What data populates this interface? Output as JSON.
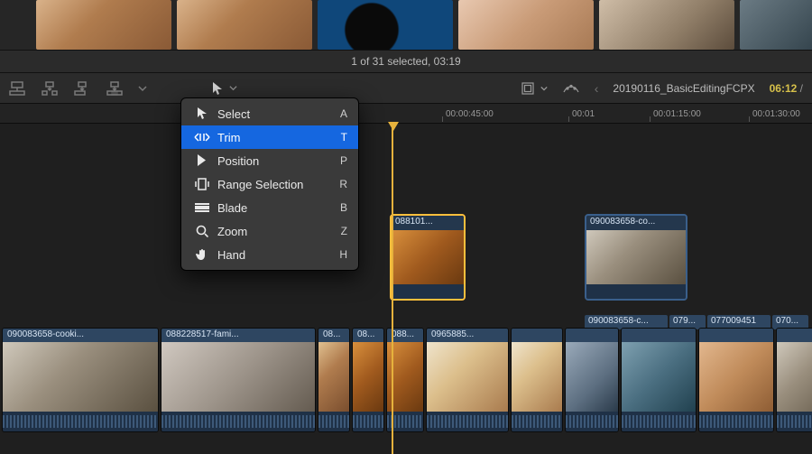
{
  "browser": {
    "status": "1 of 31 selected, 03:19"
  },
  "toolbar": {
    "project_name": "20190116_BasicEditingFCPX",
    "timecode": "06:12",
    "duration_sep": "/"
  },
  "ruler": {
    "ticks": [
      {
        "label": "00:00:45:00"
      },
      {
        "label": "00:01"
      },
      {
        "label": "00:01:15:00"
      },
      {
        "label": "00:01:30:00"
      }
    ]
  },
  "tool_menu": {
    "items": [
      {
        "icon": "cursor",
        "label": "Select",
        "shortcut": "A",
        "selected": false
      },
      {
        "icon": "trim",
        "label": "Trim",
        "shortcut": "T",
        "selected": true
      },
      {
        "icon": "position",
        "label": "Position",
        "shortcut": "P",
        "selected": false
      },
      {
        "icon": "range",
        "label": "Range Selection",
        "shortcut": "R",
        "selected": false
      },
      {
        "icon": "blade",
        "label": "Blade",
        "shortcut": "B",
        "selected": false
      },
      {
        "icon": "zoom",
        "label": "Zoom",
        "shortcut": "Z",
        "selected": false
      },
      {
        "icon": "hand",
        "label": "Hand",
        "shortcut": "H",
        "selected": false
      }
    ]
  },
  "connected_clips": [
    {
      "label": "088101...",
      "selected": true
    },
    {
      "label": "090083658-co...",
      "selected": false
    }
  ],
  "secondary_clips": [
    {
      "label": "090083658-c..."
    },
    {
      "label": "079..."
    },
    {
      "label": "077009451"
    },
    {
      "label": "070..."
    }
  ],
  "primary_clips": [
    {
      "label": "090083658-cooki...",
      "width": 174
    },
    {
      "label": "088228517-fami...",
      "width": 172
    },
    {
      "label": "08...",
      "width": 36
    },
    {
      "label": "08...",
      "width": 36
    },
    {
      "label": "088...",
      "width": 42
    },
    {
      "label": "0965885...",
      "width": 92
    },
    {
      "label": "",
      "width": 58
    },
    {
      "label": "",
      "width": 60
    },
    {
      "label": "",
      "width": 84
    },
    {
      "label": "",
      "width": 84
    },
    {
      "label": "",
      "width": 84
    }
  ]
}
